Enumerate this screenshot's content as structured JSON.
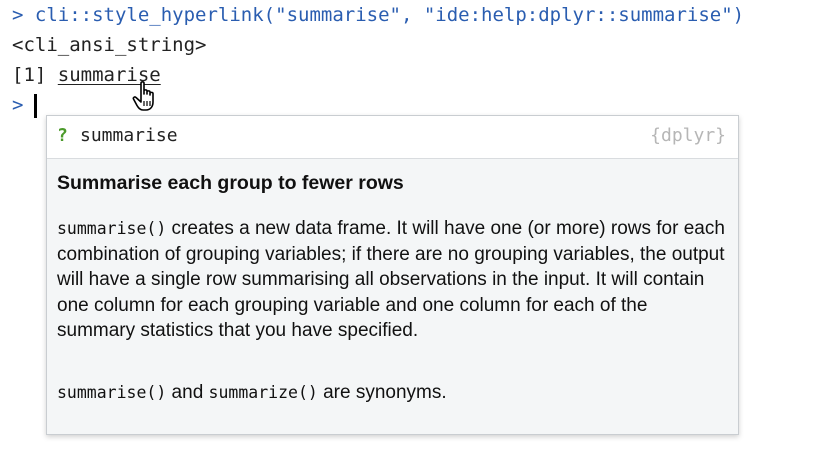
{
  "console": {
    "prompt_symbol": ">",
    "command": "cli::style_hyperlink(\"summarise\", \"ide:help:dplyr::summarise\")",
    "output_class": "<cli_ansi_string>",
    "output_index": "[1]",
    "output_link": "summarise",
    "current_prompt": ">"
  },
  "popup": {
    "icon": "?",
    "function_name": "summarise",
    "package": "{dplyr}",
    "title": "Summarise each group to fewer rows",
    "description_code": "summarise()",
    "description_text": " creates a new data frame. It will have one (or more) rows for each combination of grouping variables; if there are no grouping variables, the output will have a single row summarising all observations in the input. It will contain one column for each grouping variable and one column for each of the summary statistics that you have specified.",
    "note_code_1": "summarise()",
    "note_text_1": " and ",
    "note_code_2": "summarize()",
    "note_text_2": " are synonyms."
  },
  "colors": {
    "prompt": "#2a5db0",
    "help_icon": "#4b9a2a",
    "package_label": "#b6b6b6",
    "popup_background": "#f4f6f7"
  },
  "icons": {
    "cursor": "hand-pointer-icon",
    "help": "question-mark-icon"
  }
}
